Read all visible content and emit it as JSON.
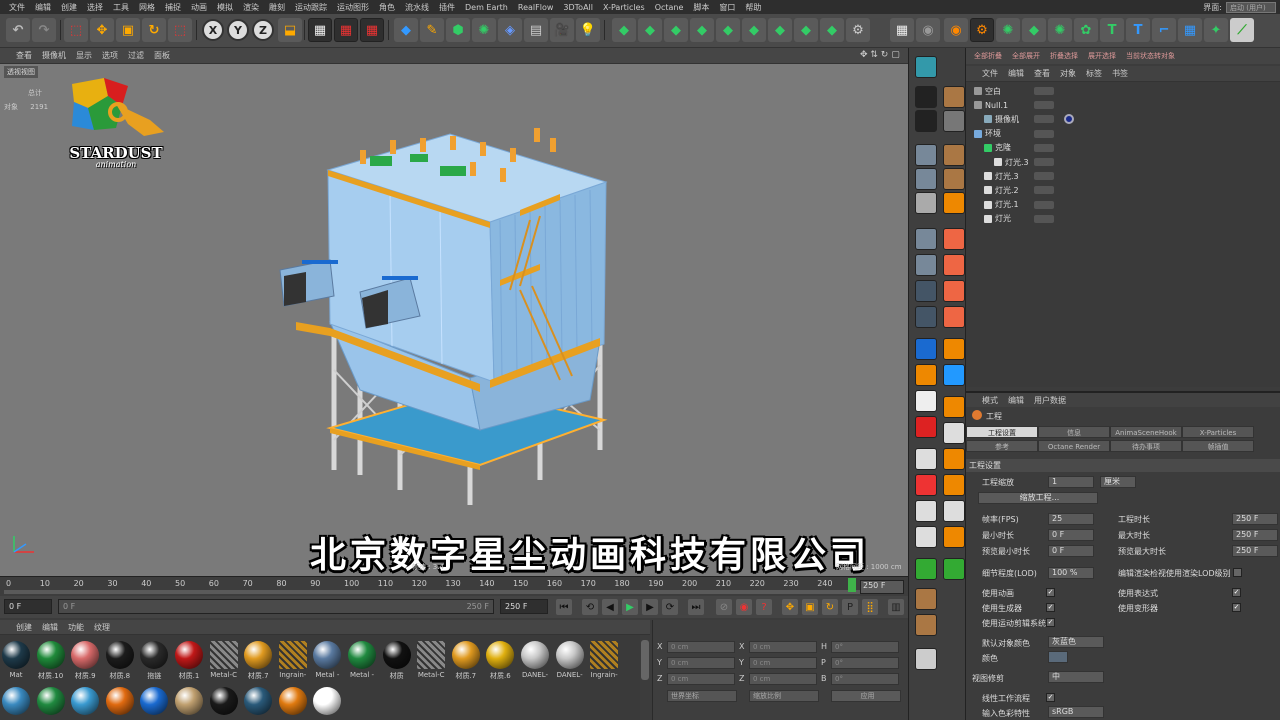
{
  "menu": [
    "文件",
    "编辑",
    "创建",
    "选择",
    "工具",
    "网格",
    "捕捉",
    "动画",
    "模拟",
    "渲染",
    "雕刻",
    "运动跟踪",
    "运动图形",
    "角色",
    "流水线",
    "插件",
    "Dem Earth",
    "RealFlow",
    "3DToAll",
    "X-Particles",
    "Octane",
    "脚本",
    "窗口",
    "帮助"
  ],
  "layout_label": "界面:",
  "layout_value": "启动 (用户)",
  "toolbar": {
    "axis_x": "X",
    "axis_y": "Y",
    "axis_z": "Z"
  },
  "viewport": {
    "menu": [
      "查看",
      "摄像机",
      "显示",
      "选项",
      "过滤",
      "面板"
    ],
    "label": "透视视图",
    "stats_total_label": "总计",
    "stats_objects_label": "对象",
    "stats_objects_value": "2191",
    "speed": "帧速 : 3.4",
    "grid": "网格间距 : 1000 cm"
  },
  "logo": {
    "name": "STARDUST",
    "sub": "animation"
  },
  "caption": "北京数字星尘动画科技有限公司",
  "timeline": {
    "ticks": [
      "0",
      "10",
      "20",
      "30",
      "40",
      "50",
      "60",
      "70",
      "80",
      "90",
      "100",
      "110",
      "120",
      "130",
      "140",
      "150",
      "160",
      "170",
      "180",
      "190",
      "200",
      "210",
      "220",
      "230",
      "240"
    ],
    "end_frame": "250 F",
    "current": "0 F",
    "range_start": "0 F",
    "range_end": "250 F",
    "range_end2": "250 F"
  },
  "materials": {
    "menu": [
      "创建",
      "编辑",
      "功能",
      "纹理"
    ],
    "items": [
      {
        "label": "Mat",
        "color": "#1e3a4a"
      },
      {
        "label": "材质.10",
        "color": "#1f8a3a"
      },
      {
        "label": "材质.9",
        "color": "#d86a6a"
      },
      {
        "label": "材质.8",
        "color": "#1c1c1c"
      },
      {
        "label": "拖链",
        "color": "#2a2a2a"
      },
      {
        "label": "材质.1",
        "color": "#c01818"
      },
      {
        "label": "Metal-C",
        "color": "#888888"
      },
      {
        "label": "材质.7",
        "color": "#e09a20"
      },
      {
        "label": "Ingrain-",
        "color": "#b08020"
      },
      {
        "label": "Metal -",
        "color": "#5a7aa0"
      },
      {
        "label": "Metal -",
        "color": "#208a40"
      },
      {
        "label": "材质",
        "color": "#111111"
      },
      {
        "label": "Metal-C",
        "color": "#888888"
      },
      {
        "label": "材质.7",
        "color": "#e09a20"
      },
      {
        "label": "材质.6",
        "color": "#e0b010"
      },
      {
        "label": "DANEL-",
        "color": "#c8c8c8"
      },
      {
        "label": "DANEL-",
        "color": "#c8c8c8"
      },
      {
        "label": "Ingrain-",
        "color": "#b08020"
      }
    ],
    "row2": [
      "#3a8ac0",
      "#208a40",
      "#3a9ad0",
      "#e06a10",
      "#1a6ad0",
      "#c0a070",
      "#1a1a1a",
      "#2a5a7a",
      "#e07a10",
      "#ffffff"
    ]
  },
  "coords": {
    "x": "X",
    "y": "Y",
    "z": "Z",
    "h": "H",
    "p": "P",
    "b": "B",
    "v0": "0 cm",
    "a0": "0°",
    "world": "世界坐标",
    "scale": "缩放比例",
    "apply": "应用"
  },
  "object_manager": {
    "toolbar": [
      "全部折叠",
      "全部展开",
      "折叠选择",
      "展开选择",
      "当前状态转对象"
    ],
    "menu": [
      "文件",
      "编辑",
      "查看",
      "对象",
      "标签",
      "书签"
    ],
    "objects": [
      {
        "name": "空白",
        "indent": 0,
        "color": "#999"
      },
      {
        "name": "Null.1",
        "indent": 0,
        "color": "#999"
      },
      {
        "name": "摄像机",
        "indent": 1,
        "color": "#8ab"
      },
      {
        "name": "环境",
        "indent": 0,
        "color": "#7ad"
      },
      {
        "name": "克隆",
        "indent": 1,
        "color": "#3c6"
      },
      {
        "name": "灯光.3",
        "indent": 2,
        "color": "#ddd"
      },
      {
        "name": "灯光.3",
        "indent": 1,
        "color": "#ddd"
      },
      {
        "name": "灯光.2",
        "indent": 1,
        "color": "#ddd"
      },
      {
        "name": "灯光.1",
        "indent": 1,
        "color": "#ddd"
      },
      {
        "name": "灯光",
        "indent": 1,
        "color": "#ddd"
      }
    ]
  },
  "attributes": {
    "menu": [
      "模式",
      "编辑",
      "用户数据"
    ],
    "title": "工程",
    "tabs1": [
      "工程设置",
      "信息",
      "AnimaSceneHook",
      "X-Particles"
    ],
    "tabs2": [
      "参考",
      "Octane Render",
      "待办事项",
      "帧插值"
    ],
    "section": "工程设置",
    "scale_label": "工程缩放",
    "scale_value": "1",
    "scale_unit": "厘米",
    "scale_button": "缩放工程...",
    "fps_label": "帧率(FPS)",
    "fps_value": "25",
    "project_len_label": "工程时长",
    "project_len_value": "250 F",
    "min_len_label": "最小时长",
    "min_len_value": "0 F",
    "max_len_label": "最大时长",
    "max_len_value": "250 F",
    "preview_min_label": "预览最小时长",
    "preview_min_value": "0 F",
    "preview_max_label": "预览最大时长",
    "preview_max_value": "250 F",
    "lod_label": "细节程度(LOD)",
    "lod_value": "100 %",
    "lod_check_label": "编辑渲染检视使用渲染LOD级别",
    "use_anim": "使用动画",
    "use_expr": "使用表达式",
    "use_gen": "使用生成器",
    "use_deform": "使用变形器",
    "use_mograph": "使用运动剪辑系统",
    "default_color_label": "默认对象颜色",
    "default_color_value": "灰蓝色",
    "color_label": "颜色",
    "view_clip_label": "视图修剪",
    "view_clip_value": "中",
    "linear_label": "线性工作流程",
    "input_color_label": "输入色彩特性",
    "input_color_value": "sRGB"
  }
}
